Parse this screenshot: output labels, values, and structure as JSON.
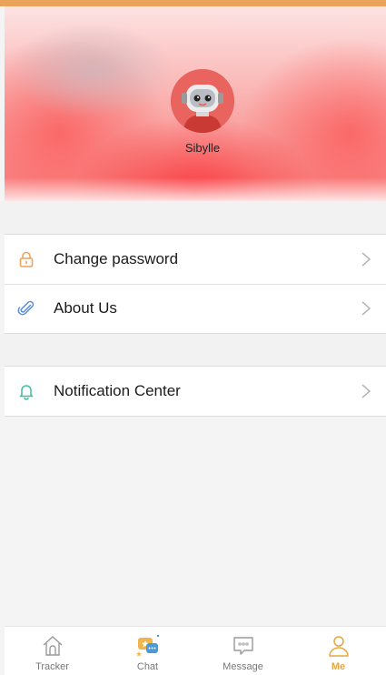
{
  "profile": {
    "username": "Sibylle"
  },
  "menu_group_1": [
    {
      "label": "Change password",
      "icon": "lock-icon",
      "icon_color": "#e9a45a"
    },
    {
      "label": "About Us",
      "icon": "paperclip-icon",
      "icon_color": "#5a8fd8"
    }
  ],
  "menu_group_2": [
    {
      "label": "Notification Center",
      "icon": "bell-icon",
      "icon_color": "#3fbf9e"
    }
  ],
  "tabs": [
    {
      "label": "Tracker",
      "icon": "house-icon",
      "active": false
    },
    {
      "label": "Chat",
      "icon": "chat-bubbles-icon",
      "active": false
    },
    {
      "label": "Message",
      "icon": "message-bubble-icon",
      "active": false
    },
    {
      "label": "Me",
      "icon": "person-icon",
      "active": true
    }
  ],
  "colors": {
    "accent": "#e7a63f",
    "header_red": "#f87e7c",
    "background": "#f4f4f4"
  }
}
